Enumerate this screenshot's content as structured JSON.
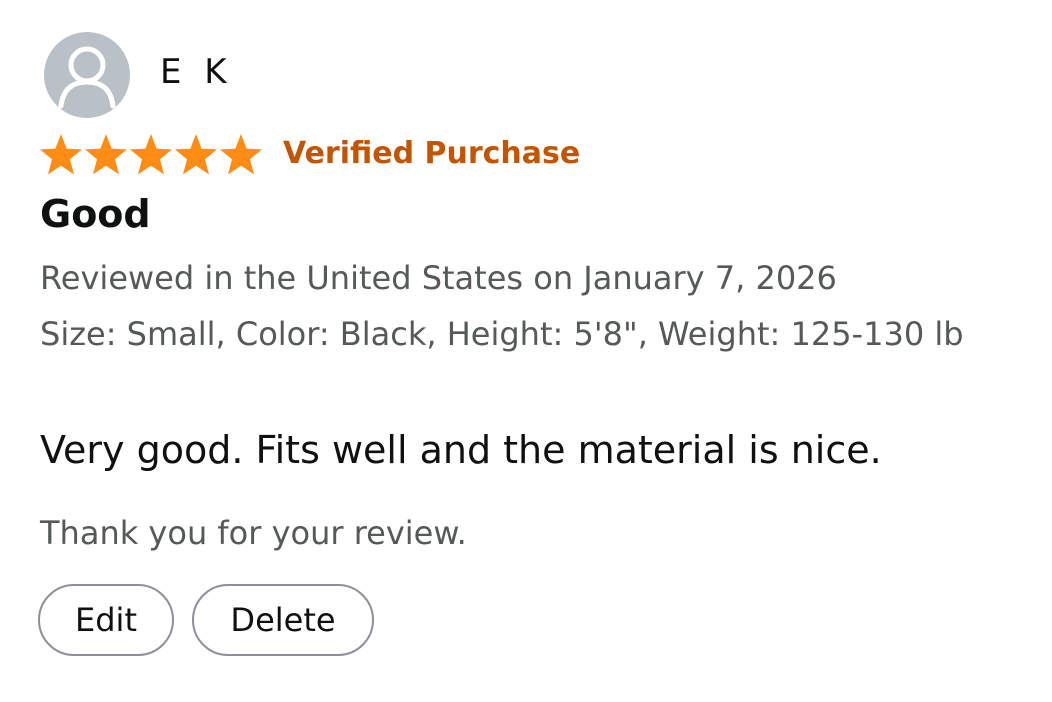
{
  "review": {
    "author": "E K",
    "avatar_icon": "default-user-icon",
    "rating": 5,
    "rating_max": 5,
    "star_color": "#ff8c14",
    "verified_label": "Verified Purchase",
    "verified_color": "#c45500",
    "title": "Good",
    "date_line": "Reviewed in the United States on January 7, 2026",
    "variant_line": "Size: Small, Color: Black, Height: 5'8\", Weight: 125-130 lb",
    "body": "Very good. Fits well and the material is nice.",
    "thanks": "Thank you for your review."
  },
  "actions": {
    "edit_label": "Edit",
    "delete_label": "Delete"
  }
}
